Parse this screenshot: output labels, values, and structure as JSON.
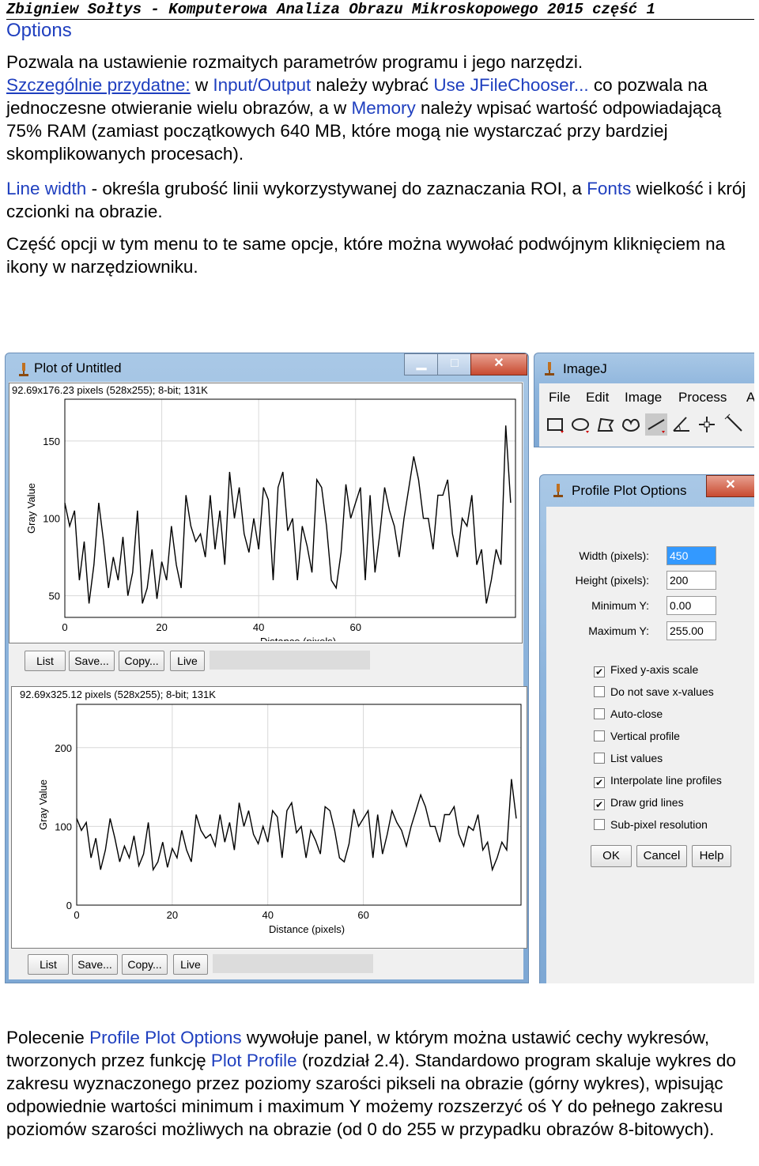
{
  "header": {
    "running_title": "Zbigniew Sołtys -  Komputerowa Analiza Obrazu Mikroskopowego 2015 część 1"
  },
  "section_title": "Options",
  "para1": {
    "t1": "Pozwala na ustawienie rozmaitych parametrów programu i jego narzędzi.",
    "t2": "Szczególnie przydatne:",
    "t3": " w ",
    "t4": "Input/Output",
    "t5": " należy wybrać ",
    "t6": "Use JFileChooser...",
    "t7": " co pozwala na jednoczesne otwieranie wielu obrazów, a w ",
    "t8": "Memory",
    "t9": " należy wpisać wartość odpowiadającą 75% RAM (zamiast początkowych 640 MB, które mogą nie wystarczać przy bardziej skomplikowanych procesach)."
  },
  "para2": {
    "t1": "Line width",
    "t2": " - określa grubość linii wykorzystywanej do zaznaczania ROI, a ",
    "t3": "Fonts",
    "t4": " wielkość i krój czcionki na obrazie."
  },
  "para3": "Część opcji w tym menu to te same opcje, które można wywołać podwójnym kliknięciem na ikony w narzędziowniku.",
  "plot_window": {
    "title": "Plot of Untitled",
    "plot1_info": "92.69x176.23 pixels (528x255); 8-bit; 131K",
    "plot2_info": "92.69x325.12 pixels (528x255); 8-bit; 131K",
    "buttons": [
      "List",
      "Save...",
      "Copy...",
      "Live"
    ]
  },
  "imagej_window": {
    "title": "ImageJ",
    "menu": [
      "File",
      "Edit",
      "Image",
      "Process",
      "A"
    ]
  },
  "options_dialog": {
    "title": "Profile Plot Options",
    "fields": [
      {
        "label": "Width (pixels):",
        "value": "450"
      },
      {
        "label": "Height (pixels):",
        "value": "200"
      },
      {
        "label": "Minimum Y:",
        "value": "0.00"
      },
      {
        "label": "Maximum Y:",
        "value": "255.00"
      }
    ],
    "checkboxes": [
      {
        "label": "Fixed y-axis scale",
        "checked": true
      },
      {
        "label": "Do not save x-values",
        "checked": false
      },
      {
        "label": "Auto-close",
        "checked": false
      },
      {
        "label": "Vertical profile",
        "checked": false
      },
      {
        "label": "List values",
        "checked": false
      },
      {
        "label": "Interpolate line profiles",
        "checked": true
      },
      {
        "label": "Draw grid lines",
        "checked": true
      },
      {
        "label": "Sub-pixel resolution",
        "checked": false
      }
    ],
    "buttons": [
      "OK",
      "Cancel",
      "Help"
    ]
  },
  "chart_data": [
    {
      "type": "line",
      "xlabel": "Distance (pixels)",
      "ylabel": "Gray Value",
      "xlim": [
        0,
        93
      ],
      "ylim": [
        36,
        177
      ],
      "xticks": [
        0,
        20,
        40,
        60
      ],
      "yticks": [
        50,
        100,
        150
      ],
      "grid": true,
      "x": [
        0,
        1,
        2,
        3,
        4,
        5,
        6,
        7,
        8,
        9,
        10,
        11,
        12,
        13,
        14,
        15,
        16,
        17,
        18,
        19,
        20,
        21,
        22,
        23,
        24,
        25,
        26,
        27,
        28,
        29,
        30,
        31,
        32,
        33,
        34,
        35,
        36,
        37,
        38,
        39,
        40,
        41,
        42,
        43,
        44,
        45,
        46,
        47,
        48,
        49,
        50,
        51,
        52,
        53,
        54,
        55,
        56,
        57,
        58,
        59,
        60,
        61,
        62,
        63,
        64,
        65,
        66,
        67,
        68,
        69,
        70,
        71,
        72,
        73,
        74,
        75,
        76,
        77,
        78,
        79,
        80,
        81,
        82,
        83,
        84,
        85,
        86,
        87,
        88,
        89,
        90,
        91,
        92
      ],
      "y": [
        110,
        95,
        105,
        60,
        85,
        45,
        70,
        110,
        85,
        55,
        75,
        60,
        88,
        50,
        65,
        105,
        45,
        55,
        80,
        48,
        72,
        60,
        95,
        70,
        55,
        115,
        95,
        85,
        90,
        75,
        115,
        80,
        105,
        70,
        130,
        100,
        120,
        90,
        78,
        100,
        80,
        120,
        112,
        60,
        120,
        130,
        92,
        100,
        60,
        95,
        82,
        65,
        125,
        120,
        95,
        60,
        55,
        78,
        122,
        100,
        110,
        120,
        60,
        115,
        65,
        90,
        120,
        105,
        95,
        75,
        100,
        120,
        140,
        125,
        100,
        100,
        80,
        115,
        115,
        125,
        90,
        75,
        100,
        95,
        115,
        70,
        80,
        45,
        60,
        80,
        70,
        160,
        110
      ]
    },
    {
      "type": "line",
      "xlabel": "Distance (pixels)",
      "ylabel": "Gray Value",
      "xlim": [
        0,
        93
      ],
      "ylim": [
        0,
        255
      ],
      "xticks": [
        0,
        20,
        40,
        60
      ],
      "yticks": [
        0,
        100,
        200
      ],
      "grid": true,
      "x": [
        0,
        1,
        2,
        3,
        4,
        5,
        6,
        7,
        8,
        9,
        10,
        11,
        12,
        13,
        14,
        15,
        16,
        17,
        18,
        19,
        20,
        21,
        22,
        23,
        24,
        25,
        26,
        27,
        28,
        29,
        30,
        31,
        32,
        33,
        34,
        35,
        36,
        37,
        38,
        39,
        40,
        41,
        42,
        43,
        44,
        45,
        46,
        47,
        48,
        49,
        50,
        51,
        52,
        53,
        54,
        55,
        56,
        57,
        58,
        59,
        60,
        61,
        62,
        63,
        64,
        65,
        66,
        67,
        68,
        69,
        70,
        71,
        72,
        73,
        74,
        75,
        76,
        77,
        78,
        79,
        80,
        81,
        82,
        83,
        84,
        85,
        86,
        87,
        88,
        89,
        90,
        91,
        92
      ],
      "y": [
        110,
        95,
        105,
        60,
        85,
        45,
        70,
        110,
        85,
        55,
        75,
        60,
        88,
        50,
        65,
        105,
        45,
        55,
        80,
        48,
        72,
        60,
        95,
        70,
        55,
        115,
        95,
        85,
        90,
        75,
        115,
        80,
        105,
        70,
        130,
        100,
        120,
        90,
        78,
        100,
        80,
        120,
        112,
        60,
        120,
        130,
        92,
        100,
        60,
        95,
        82,
        65,
        125,
        120,
        95,
        60,
        55,
        78,
        122,
        100,
        110,
        120,
        60,
        115,
        65,
        90,
        120,
        105,
        95,
        75,
        100,
        120,
        140,
        125,
        100,
        100,
        80,
        115,
        115,
        125,
        90,
        75,
        100,
        95,
        115,
        70,
        80,
        45,
        60,
        80,
        70,
        160,
        110
      ]
    }
  ],
  "para4": {
    "t1": "Polecenie ",
    "t2": "Profile Plot Options",
    "t3": " wywołuje panel, w którym można ustawić cechy wykresów, tworzonych przez funkcję ",
    "t4": "Plot Profile",
    "t5": " (rozdział 2.4). Standardowo program skaluje wykres do zakresu wyznaczonego przez poziomy szarości pikseli na obrazie (górny wykres), wpisując odpowiednie wartości minimum i maximum Y możemy rozszerzyć oś Y do pełnego zakresu poziomów szarości możliwych na obrazie (od 0 do 255 w przypadku obrazów 8-bitowych)."
  }
}
